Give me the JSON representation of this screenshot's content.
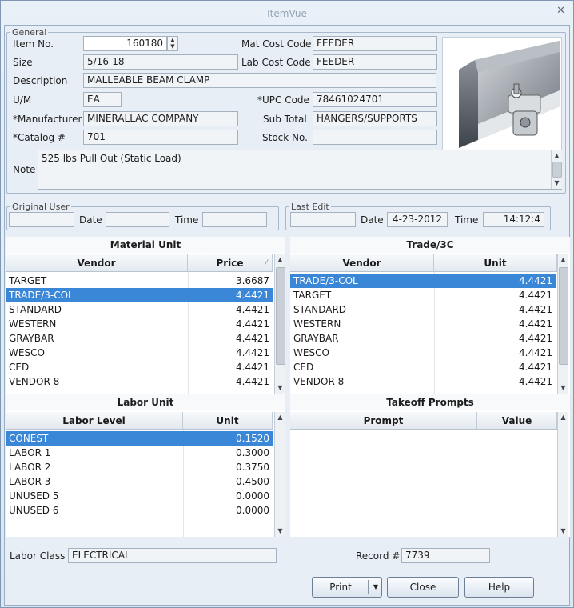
{
  "window": {
    "title": "ItemVue"
  },
  "general": {
    "legend": "General",
    "item_no_label": "Item No.",
    "item_no": "160180",
    "size_label": "Size",
    "size": "5/16-18",
    "description_label": "Description",
    "description": "MALLEABLE BEAM CLAMP",
    "um_label": "U/M",
    "um": "EA",
    "manufacturer_label": "*Manufacturer",
    "manufacturer": "MINERALLAC COMPANY",
    "catalog_label": "*Catalog #",
    "catalog": "701",
    "note_label": "Note",
    "note": "525 lbs Pull Out (Static Load)",
    "mat_cost_code_label": "Mat Cost Code",
    "mat_cost_code": "FEEDER",
    "lab_cost_code_label": "Lab Cost Code",
    "lab_cost_code": "FEEDER",
    "upc_code_label": "*UPC Code",
    "upc_code": "78461024701",
    "sub_total_label": "Sub Total",
    "sub_total": "HANGERS/SUPPORTS",
    "stock_no_label": "Stock No.",
    "stock_no": ""
  },
  "original_user": {
    "legend": "Original User",
    "user": "",
    "date_label": "Date",
    "date": "",
    "time_label": "Time",
    "time": ""
  },
  "last_edit": {
    "legend": "Last Edit",
    "user": "",
    "date_label": "Date",
    "date": "4-23-2012",
    "time_label": "Time",
    "time": "14:12:4"
  },
  "material_unit": {
    "title": "Material Unit",
    "col_vendor": "Vendor",
    "col_price": "Price",
    "rows": [
      {
        "vendor": "TARGET",
        "value": "3.6687"
      },
      {
        "vendor": "TRADE/3-COL",
        "value": "4.4421"
      },
      {
        "vendor": "STANDARD",
        "value": "4.4421"
      },
      {
        "vendor": "WESTERN",
        "value": "4.4421"
      },
      {
        "vendor": "GRAYBAR",
        "value": "4.4421"
      },
      {
        "vendor": "WESCO",
        "value": "4.4421"
      },
      {
        "vendor": "CED",
        "value": "4.4421"
      },
      {
        "vendor": "VENDOR 8",
        "value": "4.4421"
      }
    ]
  },
  "trade": {
    "title": "Trade/3C",
    "col_vendor": "Vendor",
    "col_unit": "Unit",
    "rows": [
      {
        "vendor": "TRADE/3-COL",
        "value": "4.4421"
      },
      {
        "vendor": "TARGET",
        "value": "4.4421"
      },
      {
        "vendor": "STANDARD",
        "value": "4.4421"
      },
      {
        "vendor": "WESTERN",
        "value": "4.4421"
      },
      {
        "vendor": "GRAYBAR",
        "value": "4.4421"
      },
      {
        "vendor": "WESCO",
        "value": "4.4421"
      },
      {
        "vendor": "CED",
        "value": "4.4421"
      },
      {
        "vendor": "VENDOR 8",
        "value": "4.4421"
      }
    ]
  },
  "labor_unit": {
    "title": "Labor Unit",
    "col_level": "Labor Level",
    "col_unit": "Unit",
    "rows": [
      {
        "level": "CONEST",
        "value": "0.1520"
      },
      {
        "level": "LABOR 1",
        "value": "0.3000"
      },
      {
        "level": "LABOR 2",
        "value": "0.3750"
      },
      {
        "level": "LABOR 3",
        "value": "0.4500"
      },
      {
        "level": "UNUSED 5",
        "value": "0.0000"
      },
      {
        "level": "UNUSED 6",
        "value": "0.0000"
      }
    ]
  },
  "takeoff": {
    "title": "Takeoff Prompts",
    "col_prompt": "Prompt",
    "col_value": "Value"
  },
  "footer": {
    "labor_class_label": "Labor Class",
    "labor_class": "ELECTRICAL",
    "record_label": "Record #",
    "record": "7739"
  },
  "buttons": {
    "print": "Print",
    "close": "Close",
    "help": "Help"
  },
  "colors": {
    "selection": "#3a87d8",
    "accent": "#7f97b2"
  }
}
